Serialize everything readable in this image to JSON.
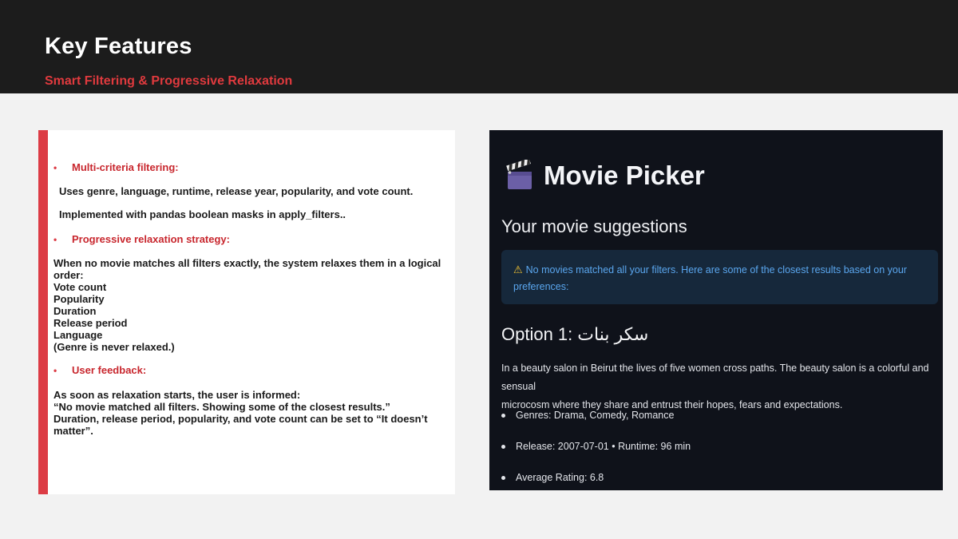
{
  "slide": {
    "title": "Key Features",
    "subtitle": "Smart Filtering & Progressive Relaxation"
  },
  "left": {
    "bullet_char": "•",
    "section1": {
      "heading": "Multi-criteria filtering:",
      "lines": [
        "Uses genre, language, runtime, release year, popularity, and vote count.",
        "Implemented with pandas boolean masks in apply_filters.."
      ]
    },
    "section2": {
      "heading": "Progressive relaxation strategy:",
      "lines": [
        "When no movie matches all filters exactly, the system relaxes them in a logical",
        "order:",
        "Vote count",
        "Popularity",
        "Duration",
        "Release period",
        "Language",
        "(Genre is never relaxed.)"
      ]
    },
    "section3": {
      "heading": "User feedback:",
      "lines": [
        "As soon as relaxation starts, the user is informed:",
        "“No movie matched all filters. Showing some of the closest results.”",
        "Duration, release period, popularity, and vote count can be set to “It doesn’t",
        "matter”."
      ]
    }
  },
  "app": {
    "title": "Movie Picker",
    "icon": "clapperboard-icon",
    "suggestions_heading": "Your movie suggestions",
    "alert": {
      "icon": "⚠",
      "line1": "No movies matched all your filters. Here are some of the closest results based on your",
      "line2": "preferences:"
    },
    "option": {
      "label": "Option 1:",
      "name": "سكر بنات"
    },
    "description": {
      "line1": "In a beauty salon in Beirut the lives of five women cross paths. The beauty salon is a colorful and sensual",
      "line2": "microcosm where they share and entrust their hopes, fears and expectations."
    },
    "details": [
      "Genres: Drama, Comedy, Romance",
      "Release: 2007-07-01 • Runtime: 96 min",
      "Average Rating: 6.8"
    ]
  },
  "colors": {
    "header_bg": "#1c1c1c",
    "accent_red": "#dc3c45",
    "panel_bg": "#0f121a",
    "alert_bg": "#16283b",
    "alert_text": "#5aa6ee"
  }
}
